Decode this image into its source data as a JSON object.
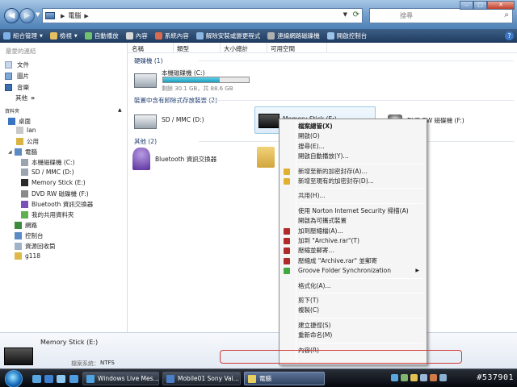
{
  "address": {
    "location": "電腦",
    "search_placeholder": "搜尋"
  },
  "toolbar": {
    "items": [
      {
        "label": "組合管理",
        "color": "#7fb0e8",
        "caret": true
      },
      {
        "label": "檢視",
        "color": "#e6c060",
        "caret": true
      },
      {
        "label": "自動播放",
        "color": "#6fc36f",
        "caret": false
      },
      {
        "label": "內容",
        "color": "#d8d8d8",
        "caret": false
      },
      {
        "label": "系統內容",
        "color": "#d66b50",
        "caret": false
      },
      {
        "label": "解除安裝或變更程式",
        "color": "#8ab6e0",
        "caret": false
      },
      {
        "label": "連線網路磁碟機",
        "color": "#b0b0b0",
        "caret": false
      },
      {
        "label": "開啟控制台",
        "color": "#9ac4ea",
        "caret": false
      }
    ],
    "help": "?"
  },
  "nav": {
    "favorites_title": "最愛的連結",
    "favorites": [
      {
        "label": "文件",
        "color": "#c8d8ec"
      },
      {
        "label": "圖片",
        "color": "#7fa8d8"
      },
      {
        "label": "音樂",
        "color": "#3c6fb0"
      }
    ],
    "more_label": "其他",
    "more_arrow": "»",
    "folders_label": "資料夾",
    "folders_caret": "▲",
    "tree": [
      {
        "label": "桌面",
        "color": "#3c74c4",
        "expander": ""
      },
      {
        "label": "Ian",
        "color": "#c8c8c8",
        "expander": ""
      },
      {
        "label": "公用",
        "color": "#d9b443",
        "expander": ""
      },
      {
        "label": "電腦",
        "color": "#5b8bc4",
        "expander": "◢"
      },
      {
        "label": "本機磁碟機 (C:)",
        "color": "#9aa5b0",
        "expander": ""
      },
      {
        "label": "SD / MMC (D:)",
        "color": "#9aa5b0",
        "expander": ""
      },
      {
        "label": "Memory Stick (E:)",
        "color": "#2b2b2b",
        "expander": ""
      },
      {
        "label": "DVD RW 磁碟機 (F:)",
        "color": "#8a8a8a",
        "expander": ""
      },
      {
        "label": "Bluetooth 資訊交換器",
        "color": "#7a4fb8",
        "expander": ""
      },
      {
        "label": "我的共用資料夾",
        "color": "#5fae4f",
        "expander": ""
      },
      {
        "label": "網路",
        "color": "#3c8a3c",
        "expander": ""
      },
      {
        "label": "控制台",
        "color": "#5b8bc4",
        "expander": ""
      },
      {
        "label": "資源回收筒",
        "color": "#9fb4c8",
        "expander": ""
      },
      {
        "label": "g118",
        "color": "#e0b84a",
        "expander": ""
      }
    ]
  },
  "columns": [
    "名稱",
    "類型",
    "大小總計",
    "可用空間"
  ],
  "groups": {
    "hdd": "硬碟機 (1)",
    "removable": "裝置中含有卸除式存放裝置 (2)",
    "other": "其他 (2)"
  },
  "drives": {
    "c": {
      "name": "本機磁碟機 (C:)",
      "usage_text": "剩餘 30.1 GB，共 88.6 GB",
      "used_fraction": 0.66
    },
    "d": {
      "name": "SD / MMC (D:)"
    },
    "e": {
      "name": "Memory Stick (E:)"
    },
    "f": {
      "name": "DVD RW 磁碟機 (F:)"
    },
    "bt": {
      "name": "Bluetooth 資訊交換器"
    }
  },
  "details": {
    "name": "Memory Stick (E:)",
    "fs_label": "檔案系統：",
    "fs_value": "NTFS"
  },
  "context_menu": {
    "items": [
      {
        "label": "檔案總管(X)",
        "bold": true,
        "icon": "",
        "submenu": false
      },
      {
        "label": "開啟(O)",
        "bold": false,
        "icon": "",
        "submenu": false
      },
      {
        "label": "搜尋(E)...",
        "bold": false,
        "icon": "",
        "submenu": false
      },
      {
        "label": "開啟自動播放(Y)...",
        "bold": false,
        "icon": "",
        "submenu": false
      },
      {
        "sep": true
      },
      {
        "label": "新增至新的加密封存(A)...",
        "bold": false,
        "icon": "#e0b030",
        "submenu": false
      },
      {
        "label": "新增至現有的加密封存(D)...",
        "bold": false,
        "icon": "#e0b030",
        "submenu": false
      },
      {
        "sep": true
      },
      {
        "label": "共用(H)...",
        "bold": false,
        "icon": "",
        "submenu": false
      },
      {
        "sep": true
      },
      {
        "label": "使用 Norton Internet Security 掃描(A)",
        "bold": false,
        "icon": "",
        "submenu": false
      },
      {
        "label": "開啟為可攜式裝置",
        "bold": false,
        "icon": "",
        "submenu": false
      },
      {
        "label": "加到壓縮檔(A)...",
        "bold": false,
        "icon": "#b02a2a",
        "submenu": false
      },
      {
        "label": "加到 \"Archive.rar\"(T)",
        "bold": false,
        "icon": "#b02a2a",
        "submenu": false
      },
      {
        "label": "壓縮並郵寄...",
        "bold": false,
        "icon": "#b02a2a",
        "submenu": false
      },
      {
        "label": "壓縮成 \"Archive.rar\" 並郵寄",
        "bold": false,
        "icon": "#b02a2a",
        "submenu": false
      },
      {
        "label": "Groove Folder Synchronization",
        "bold": false,
        "icon": "#3fa83f",
        "submenu": true
      },
      {
        "sep": true
      },
      {
        "label": "格式化(A)...",
        "bold": false,
        "icon": "",
        "submenu": false
      },
      {
        "sep": true
      },
      {
        "label": "剪下(T)",
        "bold": false,
        "icon": "",
        "submenu": false
      },
      {
        "label": "複製(C)",
        "bold": false,
        "icon": "",
        "submenu": false
      },
      {
        "sep": true
      },
      {
        "label": "建立捷徑(S)",
        "bold": false,
        "icon": "",
        "submenu": false
      },
      {
        "label": "重新命名(M)",
        "bold": false,
        "icon": "",
        "submenu": false
      },
      {
        "sep": true
      },
      {
        "label": "內容(R)",
        "bold": false,
        "icon": "",
        "submenu": false
      }
    ],
    "submenu_arrow": "▶"
  },
  "taskbar": {
    "tasks": [
      {
        "label": "Windows Live Mes...",
        "color": "#4fa3e0",
        "active": false
      },
      {
        "label": "Mobile01 Sony Vai...",
        "color": "#4a7fc8",
        "active": false
      },
      {
        "label": "電腦",
        "color": "#e8d060",
        "active": true
      }
    ],
    "watermark": "#537901"
  }
}
